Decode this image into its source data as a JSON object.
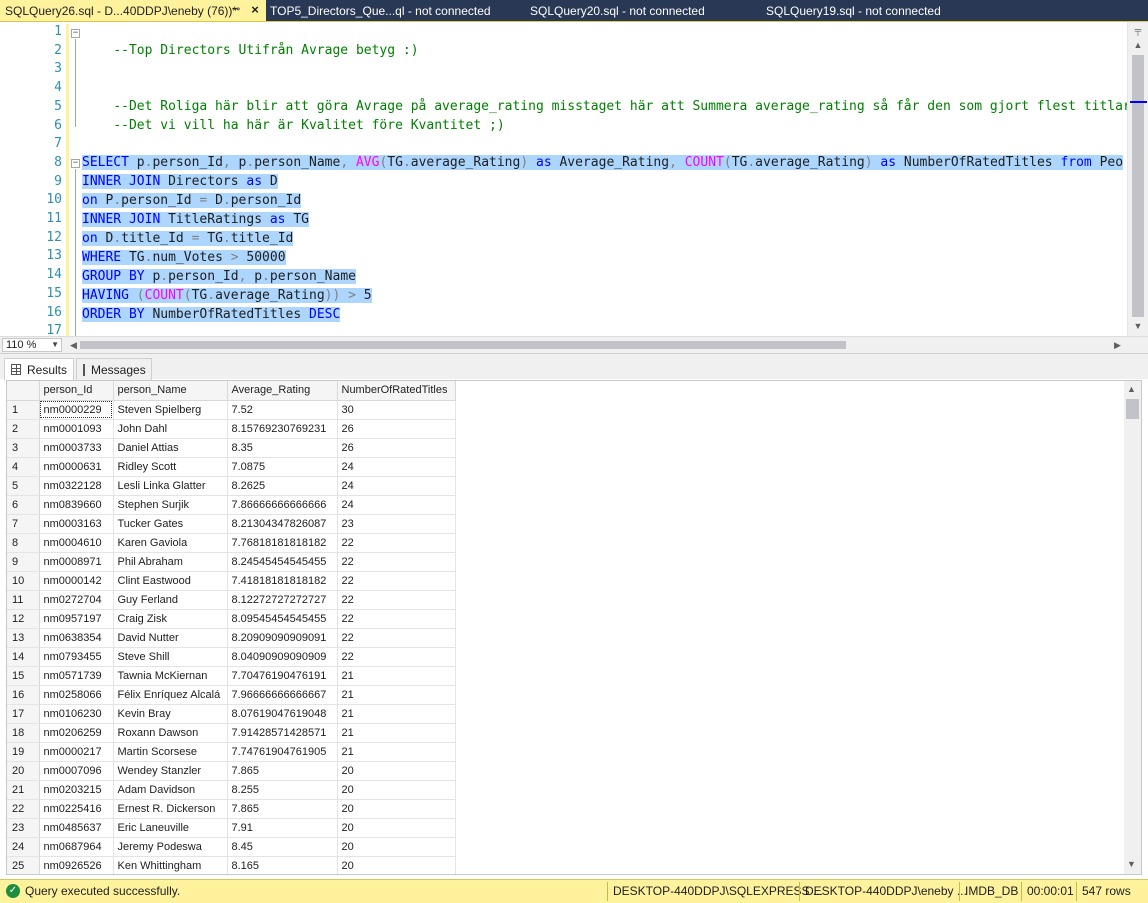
{
  "tabs": [
    {
      "label": "SQLQuery26.sql - D...40DDPJ\\eneby (76))*",
      "active": true
    },
    {
      "label": "TOP5_Directors_Que...ql - not connected",
      "active": false
    },
    {
      "label": "SQLQuery20.sql - not connected",
      "active": false
    },
    {
      "label": "SQLQuery19.sql - not connected",
      "active": false
    }
  ],
  "editor": {
    "line_numbers": [
      "1",
      "2",
      "3",
      "4",
      "5",
      "6",
      "7",
      "8",
      "9",
      "10",
      "11",
      "12",
      "13",
      "14",
      "15",
      "16",
      "17"
    ],
    "lines": {
      "l1": "--Top Directors Utifrån Avrage betyg :)",
      "l4": "--Det Roliga här blir att göra Avrage på average_rating misstaget här att Summera average_rating så får den som gjort flest titlar en",
      "l5": "--Det vi vill ha här är Kvalitet före Kvantitet ;)",
      "l8": {
        "k_select": "SELECT",
        "t1": " p",
        "g1": ".",
        "t2": "person_Id",
        "g2": ",",
        "t3": " p",
        "g3": ".",
        "t4": "person_Name",
        "g4": ",",
        "f_avg": " AVG",
        "g5": "(",
        "t5": "TG",
        "g6": ".",
        "t6": "average_Rating",
        "g7": ")",
        "k_as1": " as",
        "t7": " Average_Rating",
        "g8": ",",
        "f_count": " COUNT",
        "g9": "(",
        "t8": "TG",
        "g10": ".",
        "t9": "average_Rating",
        "g11": ")",
        "k_as2": " as",
        "t10": " NumberOfRatedTitles ",
        "k_from": "from",
        "t11": " Peo"
      },
      "l9": {
        "k1": "INNER JOIN",
        "t1": " Directors ",
        "k2": "as",
        "t2": " D"
      },
      "l10": {
        "k1": "on",
        "t1": " P",
        "g1": ".",
        "t2": "person_Id ",
        "g2": "=",
        "t3": " D",
        "g3": ".",
        "t4": "person_Id"
      },
      "l11": {
        "k1": "INNER JOIN",
        "t1": " TitleRatings ",
        "k2": "as",
        "t2": " TG"
      },
      "l12": {
        "k1": "on",
        "t1": " D",
        "g1": ".",
        "t2": "title_Id ",
        "g2": "=",
        "t3": " TG",
        "g3": ".",
        "t4": "title_Id"
      },
      "l13": {
        "k1": "WHERE",
        "t1": " TG",
        "g1": ".",
        "t2": "num_Votes ",
        "g2": ">",
        "t3": " 50000"
      },
      "l14": {
        "k1": "GROUP BY",
        "t1": " p",
        "g1": ".",
        "t2": "person_Id",
        "g2": ",",
        "t3": " p",
        "g3": ".",
        "t4": "person_Name"
      },
      "l15": {
        "k1": "HAVING",
        "g0": " (",
        "f1": "COUNT",
        "g1": "(",
        "t1": "TG",
        "g2": ".",
        "t2": "average_Rating",
        "g3": "))",
        "g4": " >",
        "t3": " 5"
      },
      "l16": {
        "k1": "ORDER BY",
        "t1": " NumberOfRatedTitles ",
        "k2": "DESC"
      }
    }
  },
  "zoom": "110 %",
  "results_tabs": {
    "results": "Results",
    "messages": "Messages"
  },
  "grid": {
    "columns": [
      "person_Id",
      "person_Name",
      "Average_Rating",
      "NumberOfRatedTitles"
    ],
    "rows": [
      [
        "1",
        "nm0000229",
        "Steven Spielberg",
        "7.52",
        "30"
      ],
      [
        "2",
        "nm0001093",
        "John Dahl",
        "8.15769230769231",
        "26"
      ],
      [
        "3",
        "nm0003733",
        "Daniel Attias",
        "8.35",
        "26"
      ],
      [
        "4",
        "nm0000631",
        "Ridley Scott",
        "7.0875",
        "24"
      ],
      [
        "5",
        "nm0322128",
        "Lesli Linka Glatter",
        "8.2625",
        "24"
      ],
      [
        "6",
        "nm0839660",
        "Stephen Surjik",
        "7.86666666666666",
        "24"
      ],
      [
        "7",
        "nm0003163",
        "Tucker Gates",
        "8.21304347826087",
        "23"
      ],
      [
        "8",
        "nm0004610",
        "Karen Gaviola",
        "7.76818181818182",
        "22"
      ],
      [
        "9",
        "nm0008971",
        "Phil Abraham",
        "8.24545454545455",
        "22"
      ],
      [
        "10",
        "nm0000142",
        "Clint Eastwood",
        "7.41818181818182",
        "22"
      ],
      [
        "11",
        "nm0272704",
        "Guy Ferland",
        "8.12272727272727",
        "22"
      ],
      [
        "12",
        "nm0957197",
        "Craig Zisk",
        "8.09545454545455",
        "22"
      ],
      [
        "13",
        "nm0638354",
        "David Nutter",
        "8.20909090909091",
        "22"
      ],
      [
        "14",
        "nm0793455",
        "Steve Shill",
        "8.04090909090909",
        "22"
      ],
      [
        "15",
        "nm0571739",
        "Tawnia McKiernan",
        "7.70476190476191",
        "21"
      ],
      [
        "16",
        "nm0258066",
        "Félix Enríquez Alcalá",
        "7.96666666666667",
        "21"
      ],
      [
        "17",
        "nm0106230",
        "Kevin Bray",
        "8.07619047619048",
        "21"
      ],
      [
        "18",
        "nm0206259",
        "Roxann Dawson",
        "7.91428571428571",
        "21"
      ],
      [
        "19",
        "nm0000217",
        "Martin Scorsese",
        "7.74761904761905",
        "21"
      ],
      [
        "20",
        "nm0007096",
        "Wendey Stanzler",
        "7.865",
        "20"
      ],
      [
        "21",
        "nm0203215",
        "Adam Davidson",
        "8.255",
        "20"
      ],
      [
        "22",
        "nm0225416",
        "Ernest R. Dickerson",
        "7.865",
        "20"
      ],
      [
        "23",
        "nm0485637",
        "Eric Laneuville",
        "7.91",
        "20"
      ],
      [
        "24",
        "nm0687964",
        "Jeremy Podeswa",
        "8.45",
        "20"
      ],
      [
        "25",
        "nm0926526",
        "Ken Whittingham",
        "8.165",
        "20"
      ]
    ]
  },
  "status": {
    "message": "Query executed successfully.",
    "server": "DESKTOP-440DDPJ\\SQLEXPRESS ...",
    "user": "DESKTOP-440DDPJ\\eneby ...",
    "database": "IMDB_DB",
    "elapsed": "00:00:01",
    "rows": "547 rows"
  },
  "colors": {
    "accent_yellow": "#fff29d",
    "tab_bar": "#293955",
    "selection": "#add6ff",
    "comment": "#008000",
    "keyword": "#0000ff",
    "function": "#ff00ff"
  },
  "icons": {
    "pin": "pin-icon",
    "close": "close-icon",
    "results": "grid-icon",
    "messages": "messages-icon",
    "status": "check-circle-icon"
  }
}
